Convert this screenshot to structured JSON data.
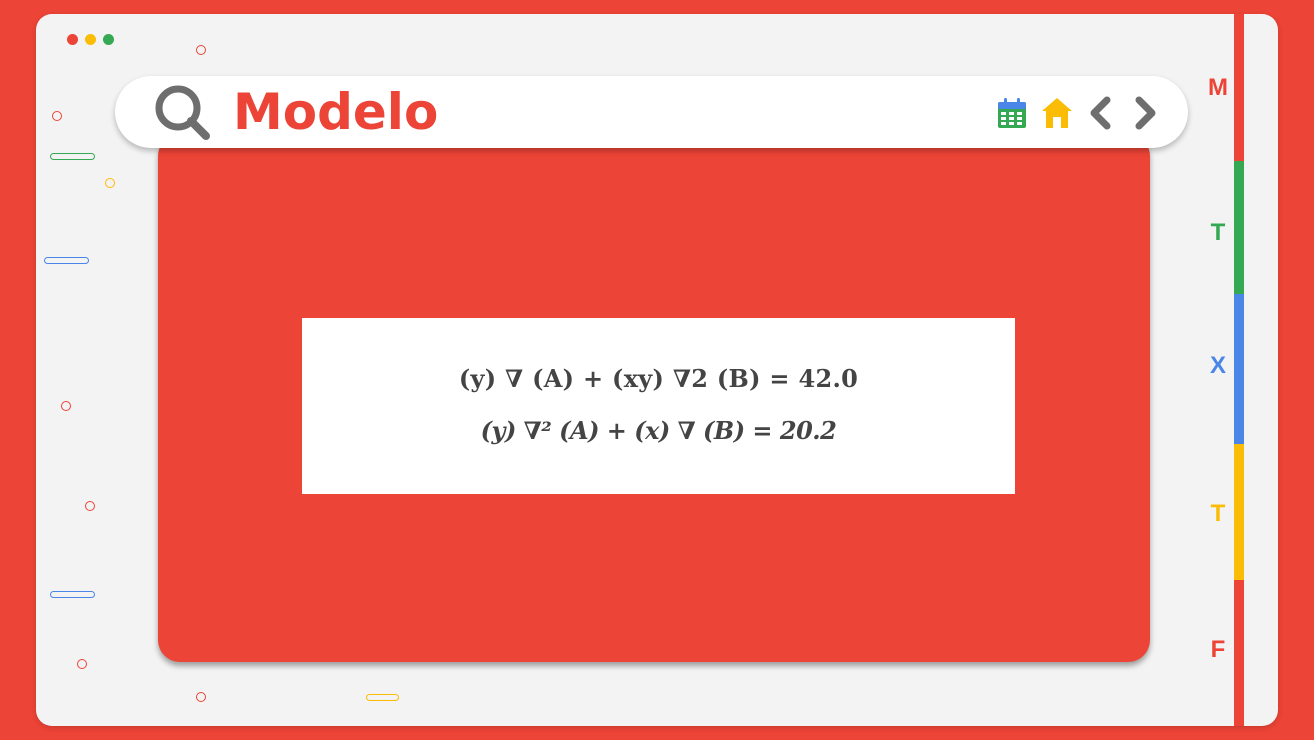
{
  "header": {
    "title": "Modelo"
  },
  "icons": {
    "search": "search-icon",
    "calendar": "calendar-icon",
    "home": "home-icon",
    "prev": "chevron-left-icon",
    "next": "chevron-right-icon"
  },
  "equations": {
    "line1": "(y) ∇ (A)  +  (xy) ∇2 (B) =  42.0",
    "line2": "(y) ∇² (A) + (x) ∇ (B) = 20.2"
  },
  "side_tabs": [
    {
      "label": "M",
      "color": "#EC4436"
    },
    {
      "label": "T",
      "color": "#34A853"
    },
    {
      "label": "X",
      "color": "#4A86E8"
    },
    {
      "label": "T",
      "color": "#FBBC05"
    },
    {
      "label": "F",
      "color": "#EC4436"
    }
  ],
  "colors": {
    "red": "#EC4436",
    "green": "#34A853",
    "blue": "#4A86E8",
    "yellow": "#FBBC05",
    "gray": "#6E6E6E"
  }
}
